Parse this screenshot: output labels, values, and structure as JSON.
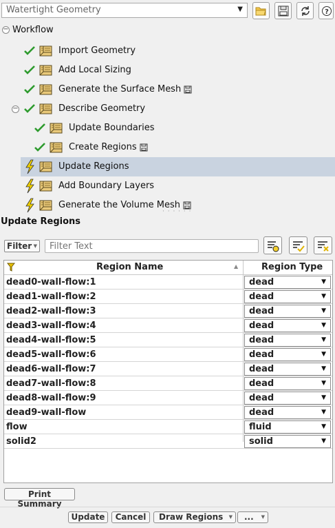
{
  "toolbar": {
    "workflow_select": "Watertight Geometry",
    "buttons": [
      "open-folder-icon",
      "save-icon",
      "refresh-icon",
      "help-icon"
    ]
  },
  "workflow": {
    "root_label": "Workflow",
    "tasks": [
      {
        "label": "Import Geometry",
        "status": "done",
        "icon": "cad-import-icon",
        "has_save": false
      },
      {
        "label": "Add Local Sizing",
        "status": "done",
        "icon": "sizing-grid-icon",
        "has_save": false
      },
      {
        "label": "Generate the Surface Mesh",
        "status": "done",
        "icon": "surface-mesh-icon",
        "has_save": true
      },
      {
        "label": "Describe Geometry",
        "status": "done",
        "icon": "describe-geometry-icon",
        "has_save": false
      },
      {
        "label": "Update Boundaries",
        "status": "done",
        "icon": "update-boundaries-icon",
        "has_save": false
      },
      {
        "label": "Create Regions",
        "status": "done",
        "icon": "create-regions-icon",
        "has_save": true
      },
      {
        "label": "Update Regions",
        "status": "pending",
        "icon": "update-regions-icon",
        "has_save": false
      },
      {
        "label": "Add Boundary Layers",
        "status": "pending",
        "icon": "boundary-layers-icon",
        "has_save": false
      },
      {
        "label": "Generate the Volume Mesh",
        "status": "pending",
        "icon": "volume-mesh-icon",
        "has_save": true
      }
    ]
  },
  "panel": {
    "title": "Update Regions",
    "filter_label": "Filter",
    "filter_placeholder": "Filter Text",
    "columns": {
      "name": "Region Name",
      "type": "Region Type"
    },
    "rows": [
      {
        "name": "dead0-wall-flow:1",
        "type": "dead"
      },
      {
        "name": "dead1-wall-flow:2",
        "type": "dead"
      },
      {
        "name": "dead2-wall-flow:3",
        "type": "dead"
      },
      {
        "name": "dead3-wall-flow:4",
        "type": "dead"
      },
      {
        "name": "dead4-wall-flow:5",
        "type": "dead"
      },
      {
        "name": "dead5-wall-flow:6",
        "type": "dead"
      },
      {
        "name": "dead6-wall-flow:7",
        "type": "dead"
      },
      {
        "name": "dead7-wall-flow:8",
        "type": "dead"
      },
      {
        "name": "dead8-wall-flow:9",
        "type": "dead"
      },
      {
        "name": "dead9-wall-flow",
        "type": "dead"
      },
      {
        "name": "flow",
        "type": "fluid"
      },
      {
        "name": "solid2",
        "type": "solid"
      }
    ],
    "print_summary": "Print Summary"
  },
  "actions": {
    "update": "Update",
    "cancel": "Cancel",
    "draw_regions": "Draw Regions",
    "more": "..."
  },
  "colors": {
    "check": "#2e9b2e",
    "bolt": "#f0d000",
    "selected_row": "#c9d3e0"
  }
}
